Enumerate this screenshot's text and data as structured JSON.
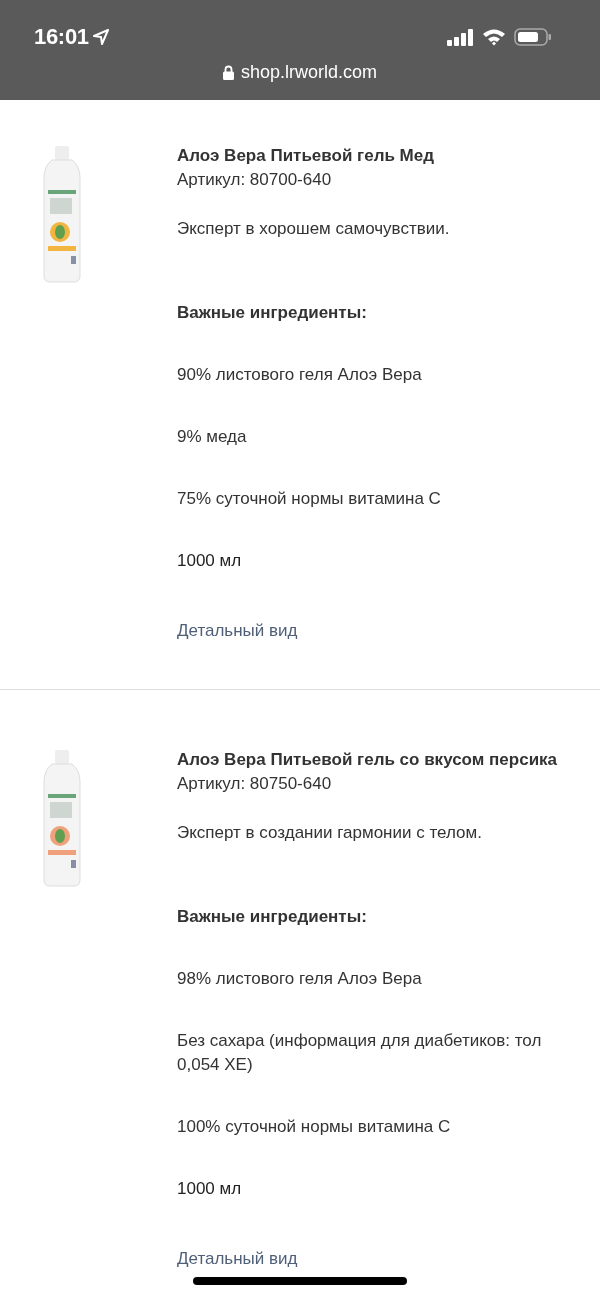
{
  "status_bar": {
    "time": "16:01"
  },
  "browser": {
    "url": "shop.lrworld.com"
  },
  "products": [
    {
      "title": "Алоэ Вера Питьевой гель Мед",
      "article": "Артикул: 80700-640",
      "tagline": "Эксперт в хорошем самочувствии.",
      "ingredients_heading": "Важные ингредиенты:",
      "ingredients": [
        "90% листового геля Алоэ Вера",
        "9% меда",
        "75% суточной нормы витамина С"
      ],
      "volume": "1000 мл",
      "link": "Детальный вид"
    },
    {
      "title": "Алоэ Вера Питьевой гель со вкусом персика",
      "article": "Артикул: 80750-640",
      "tagline": "Эксперт в создании гармонии с телом.",
      "ingredients_heading": "Важные ингредиенты:",
      "ingredients": [
        "98% листового геля Алоэ Вера",
        "Без сахара (информация для диабетиков: тол\n0,054 ХЕ)",
        "100% суточной нормы витамина С"
      ],
      "volume": "1000 мл",
      "link": "Детальный вид"
    }
  ]
}
